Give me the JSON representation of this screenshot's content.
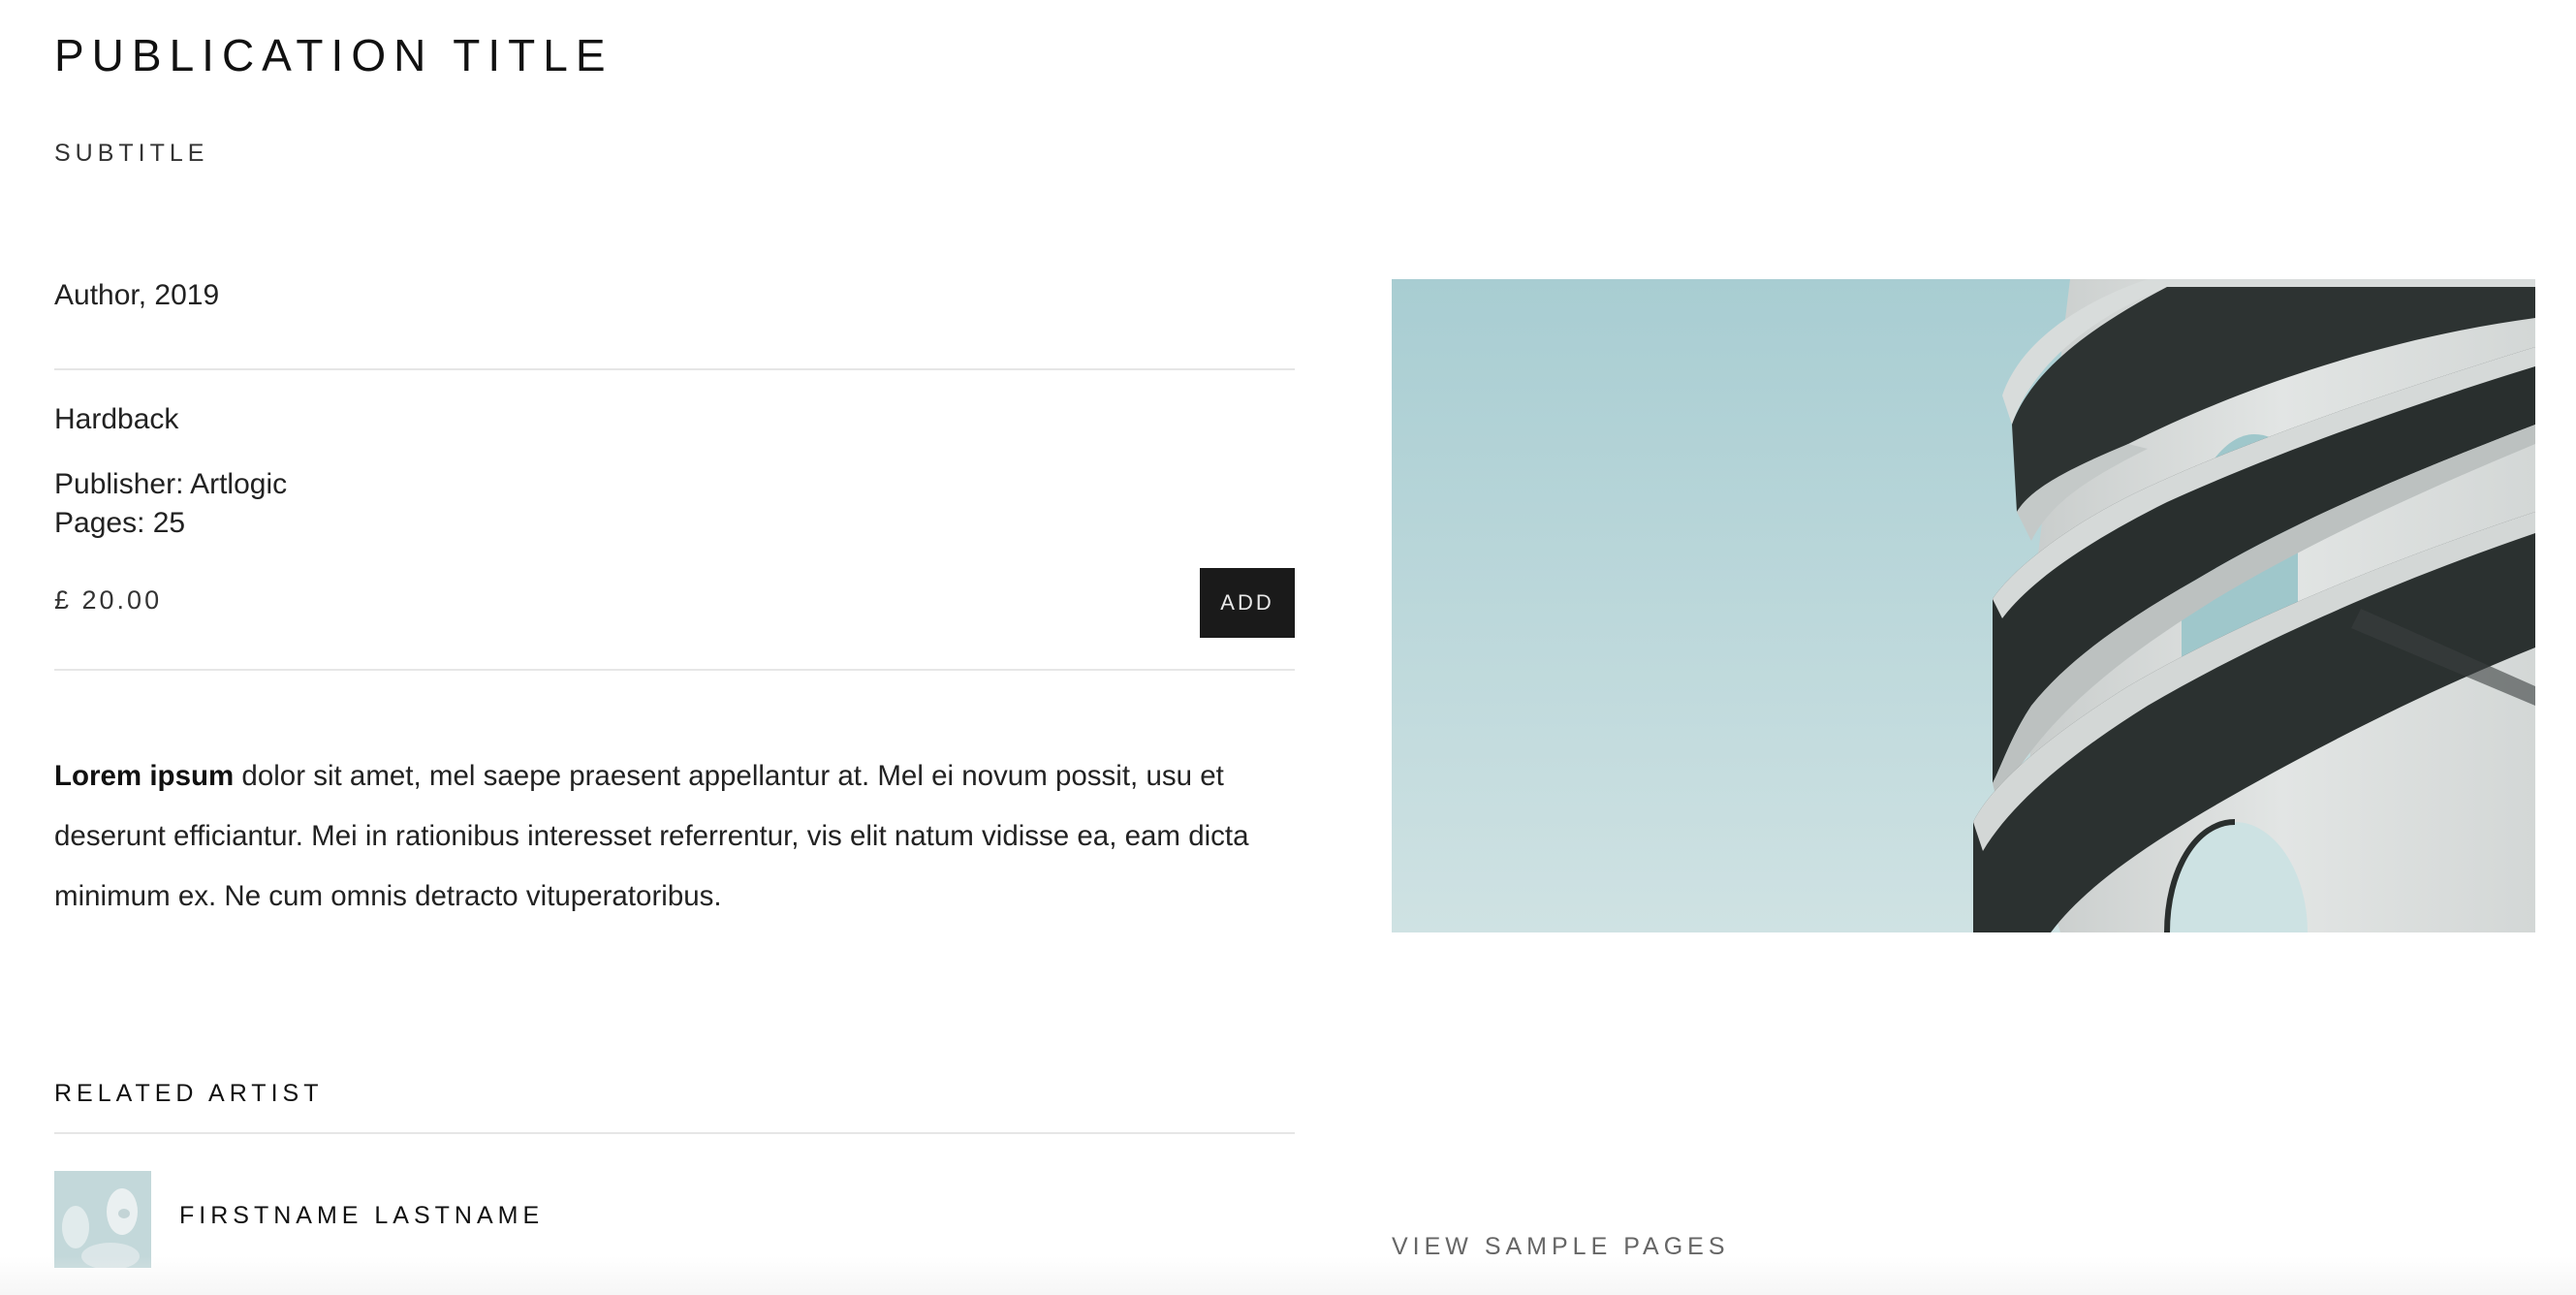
{
  "publication": {
    "title": "PUBLICATION TITLE",
    "subtitle": "SUBTITLE",
    "author_year": "Author, 2019"
  },
  "details": {
    "format": "Hardback",
    "publisher": "Publisher: Artlogic",
    "pages": "Pages: 25",
    "price": "£ 20.00",
    "add_label": "ADD"
  },
  "description": {
    "lead": "Lorem ipsum",
    "body": " dolor sit amet, mel saepe praesent appellantur at. Mel ei novum possit, usu et deserunt efficiantur. Mei in rationibus interesset referrentur, vis elit natum vidisse ea, eam dicta minimum ex. Ne cum omnis detracto vituperatoribus."
  },
  "related": {
    "heading": "RELATED ARTIST",
    "artist_name": "FIRSTNAME LASTNAME"
  },
  "gallery": {
    "sample_pages_label": "VIEW SAMPLE PAGES"
  },
  "colors": {
    "button_bg": "#1a1a1a",
    "sky_top": "#a8cdd2",
    "sky_bottom": "#cfe2e3"
  }
}
